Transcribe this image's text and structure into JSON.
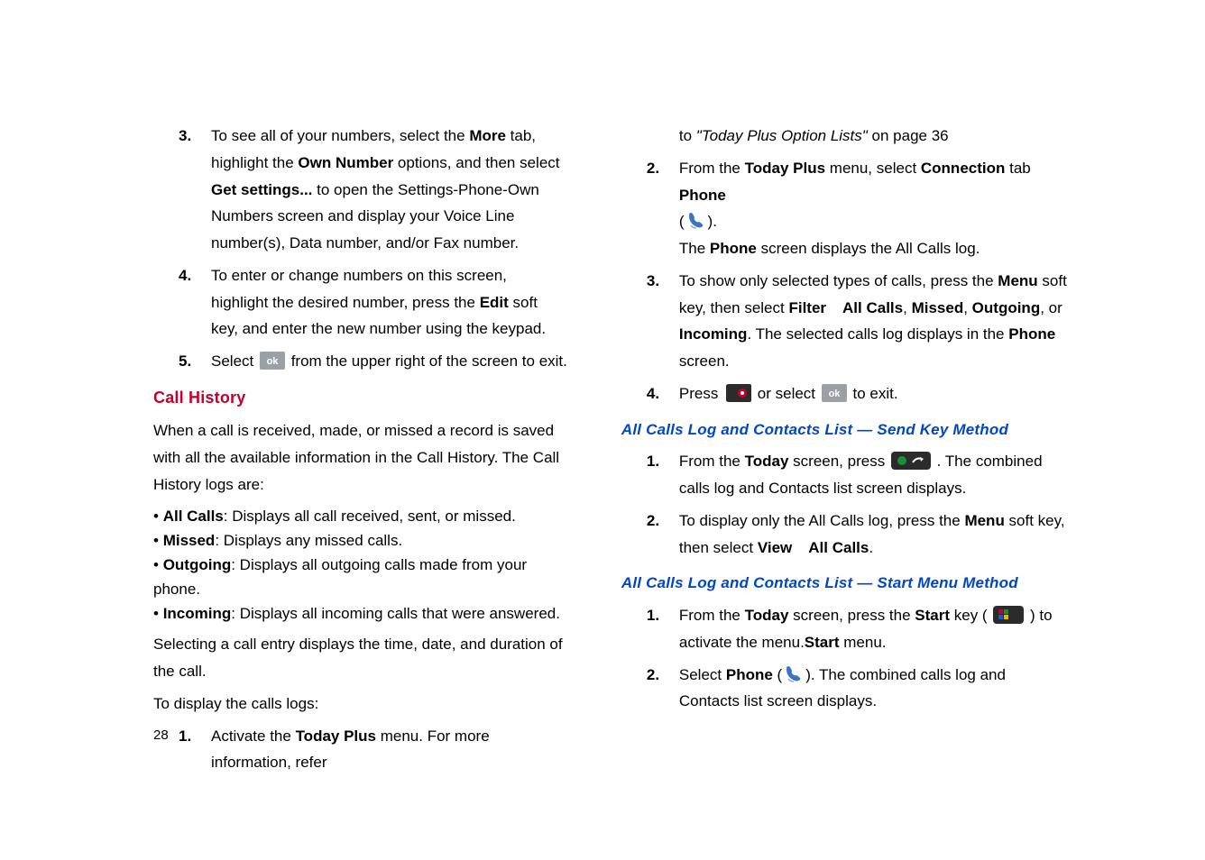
{
  "pageNumber": "28",
  "left": {
    "step3": {
      "num": "3.",
      "t1": "To see all of your numbers, select the ",
      "more": "More",
      "t2": " tab, highlight the ",
      "own": "Own Number",
      "t3": " options, and then select ",
      "getset": "Get settings...",
      "t4": " to open the Settings-Phone-Own Numbers screen and display your Voice Line number(s), Data number, and/or Fax number."
    },
    "step4": {
      "num": "4.",
      "t1": "To enter or change numbers on this screen, highlight the desired number, press the ",
      "edit": "Edit",
      "t2": " soft key, and enter the new number using the keypad."
    },
    "step5": {
      "num": "5.",
      "t1": "Select ",
      "t2": " from the upper right of the screen to exit."
    },
    "callHistory": {
      "title": "Call History",
      "intro": "When a call is received, made, or missed a record is saved with all the available information in the Call History. The Call History logs are:",
      "bullets": [
        {
          "label": "All Calls",
          "desc": ": Displays all call received, sent, or missed."
        },
        {
          "label": "Missed",
          "desc": ": Displays any missed calls."
        },
        {
          "label": "Outgoing",
          "desc": ": Displays all outgoing calls made from your phone."
        },
        {
          "label": "Incoming",
          "desc": ": Displays all incoming calls that were answered."
        }
      ],
      "para2": "Selecting a call entry displays the time, date, and duration of the call.",
      "para3": "To display the calls logs:",
      "nested1": {
        "num": "1.",
        "t1": "Activate the ",
        "tp": "Today Plus",
        "t2": " menu. For more information, refer "
      }
    }
  },
  "right": {
    "cont": {
      "t1": "to ",
      "ref": "\"Today Plus Option Lists\"",
      "t2": "  on page 36"
    },
    "step2": {
      "num": "2.",
      "t1": "From the ",
      "tp": "Today Plus",
      "t2": " menu, select ",
      "conn": "Connection",
      "t3": " tab ",
      "phone": "Phone",
      "open": "(",
      "close": ").",
      "line3a": "The ",
      "line3b": "Phone",
      "line3c": " screen displays the All Calls log."
    },
    "step3": {
      "num": "3.",
      "t1": "To show only selected types of calls, press the ",
      "menu": "Menu",
      "t2": " soft key, then select ",
      "filter": "Filter",
      "all": "All Calls",
      "missed": "Missed",
      "outgoing": "Outgoing",
      "or": ", or ",
      "incoming": "Incoming",
      "t3": ". The selected calls log displays in the ",
      "phone": "Phone",
      "t4": " screen."
    },
    "step4": {
      "num": "4.",
      "t1": "Press ",
      "t2": " or select ",
      "t3": " to exit."
    },
    "sendKey": {
      "title": "All Calls Log and Contacts List — Send Key Method",
      "s1": {
        "num": "1.",
        "t1": "From the ",
        "today": "Today",
        "t2": " screen, press ",
        "t3": " . The combined calls log and Contacts list screen displays."
      },
      "s2": {
        "num": "2.",
        "t1": "To display only the All Calls log, press the ",
        "menu": "Menu",
        "t2": " soft key, then select ",
        "view": "View",
        "all": "All Calls",
        "dot": "."
      }
    },
    "startMenu": {
      "title": "All Calls Log and Contacts List — Start Menu Method",
      "s1": {
        "num": "1.",
        "t1": "From the ",
        "today": "Today",
        "t2": " screen, press the ",
        "start": "Start",
        "t3": " key ( ",
        "t4": " ) to activate the ",
        "start2": "Start",
        "t5": " menu."
      },
      "s2": {
        "num": "2.",
        "t1": "Select ",
        "phone": "Phone",
        "open": " (",
        "close": "). The combined calls log and Contacts list screen displays."
      }
    }
  }
}
